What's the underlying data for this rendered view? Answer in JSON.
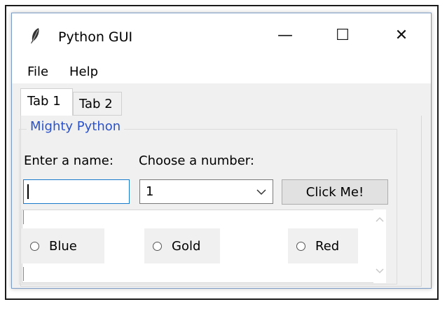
{
  "window": {
    "title": "Python GUI",
    "minimize_glyph": "—",
    "maximize_glyph": "☐",
    "close_glyph": "✕"
  },
  "menubar": {
    "items": [
      {
        "label": "File"
      },
      {
        "label": "Help"
      }
    ]
  },
  "tabs": [
    {
      "label": "Tab 1",
      "selected": true
    },
    {
      "label": "Tab 2",
      "selected": false
    }
  ],
  "group": {
    "label": "Mighty Python",
    "name_label": "Enter a name:",
    "number_label": "Choose a number:",
    "name_value": "",
    "number_value": "1",
    "button_label": "Click Me!"
  },
  "radios": [
    {
      "label": "Blue",
      "checked": false
    },
    {
      "label": "Gold",
      "checked": false
    },
    {
      "label": "Red",
      "checked": false
    }
  ],
  "colors": {
    "group_label": "#2b52c9",
    "entry_focus_border": "#1979ca"
  },
  "icons": {
    "app": "feather-icon",
    "combo": "chevron-down-icon",
    "scroll_up": "chevron-up-icon",
    "scroll_down": "chevron-down-icon"
  }
}
